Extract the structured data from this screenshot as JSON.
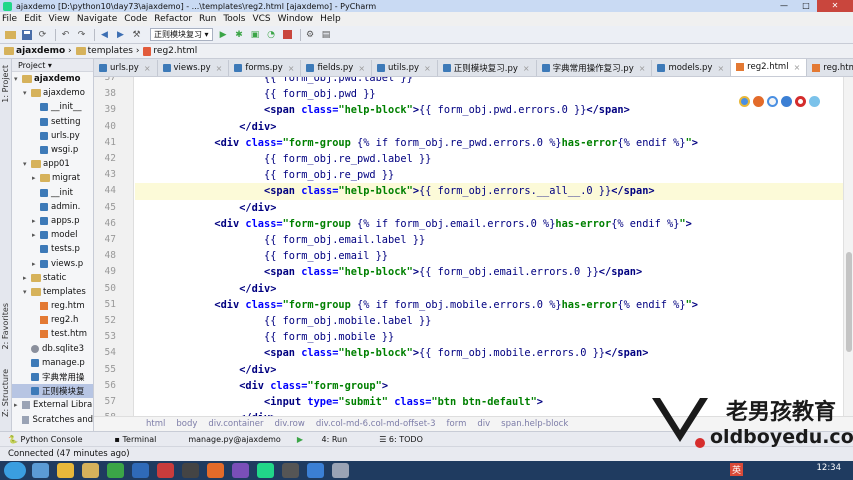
{
  "window": {
    "title": "ajaxdemo [D:\\python10\\day73\\ajaxdemo] - ...\\templates\\reg2.html [ajaxdemo] - PyCharm",
    "minimize": "—",
    "maximize": "□",
    "close": "✕"
  },
  "menu": [
    "File",
    "Edit",
    "View",
    "Navigate",
    "Code",
    "Refactor",
    "Run",
    "Tools",
    "VCS",
    "Window",
    "Help"
  ],
  "toolbar": {
    "run_config": "正则模块复习 ▾"
  },
  "navbar": {
    "crumbs": [
      "ajaxdemo",
      "templates",
      "reg2.html"
    ]
  },
  "side_tabs": {
    "project": "1: Project",
    "favorites": "2: Favorites",
    "structure": "Z: Structure"
  },
  "project_panel": {
    "header": "Project ▾",
    "tree": [
      {
        "arrow": "▾",
        "label": "ajaxdemo",
        "indent": 0,
        "kind": "folder"
      },
      {
        "arrow": "▾",
        "label": "ajaxdemo",
        "indent": 1,
        "kind": "folder"
      },
      {
        "arrow": "",
        "label": "__init__",
        "indent": 2,
        "kind": "py"
      },
      {
        "arrow": "",
        "label": "setting",
        "indent": 2,
        "kind": "py"
      },
      {
        "arrow": "",
        "label": "urls.py",
        "indent": 2,
        "kind": "py"
      },
      {
        "arrow": "",
        "label": "wsgi.p",
        "indent": 2,
        "kind": "py"
      },
      {
        "arrow": "▾",
        "label": "app01",
        "indent": 1,
        "kind": "folder"
      },
      {
        "arrow": "▸",
        "label": "migrat",
        "indent": 2,
        "kind": "folder"
      },
      {
        "arrow": "",
        "label": "__init",
        "indent": 2,
        "kind": "py"
      },
      {
        "arrow": "",
        "label": "admin.",
        "indent": 2,
        "kind": "py"
      },
      {
        "arrow": "▸",
        "label": "apps.p",
        "indent": 2,
        "kind": "py"
      },
      {
        "arrow": "▸",
        "label": "model",
        "indent": 2,
        "kind": "py"
      },
      {
        "arrow": "",
        "label": "tests.p",
        "indent": 2,
        "kind": "py"
      },
      {
        "arrow": "▸",
        "label": "views.p",
        "indent": 2,
        "kind": "py"
      },
      {
        "arrow": "▸",
        "label": "static",
        "indent": 1,
        "kind": "folder"
      },
      {
        "arrow": "▾",
        "label": "templates",
        "indent": 1,
        "kind": "folder"
      },
      {
        "arrow": "",
        "label": "reg.htm",
        "indent": 2,
        "kind": "html"
      },
      {
        "arrow": "",
        "label": "reg2.h",
        "indent": 2,
        "kind": "html"
      },
      {
        "arrow": "",
        "label": "test.htm",
        "indent": 2,
        "kind": "html"
      },
      {
        "arrow": "",
        "label": "db.sqlite3",
        "indent": 1,
        "kind": "db"
      },
      {
        "arrow": "",
        "label": "manage.p",
        "indent": 1,
        "kind": "py"
      },
      {
        "arrow": "",
        "label": "字典常用操",
        "indent": 1,
        "kind": "py"
      },
      {
        "arrow": "",
        "label": "正则模块复",
        "indent": 1,
        "kind": "py",
        "selected": true
      },
      {
        "arrow": "▸",
        "label": "External Libra",
        "indent": 0,
        "kind": "lib"
      },
      {
        "arrow": "",
        "label": "Scratches and",
        "indent": 0,
        "kind": "lib"
      }
    ]
  },
  "tabs": [
    {
      "label": "urls.py",
      "active": false
    },
    {
      "label": "views.py",
      "active": false
    },
    {
      "label": "forms.py",
      "active": false
    },
    {
      "label": "fields.py",
      "active": false
    },
    {
      "label": "utils.py",
      "active": false
    },
    {
      "label": "正则模块复习.py",
      "active": false
    },
    {
      "label": "字典常用操作复习.py",
      "active": false
    },
    {
      "label": "models.py",
      "active": false
    },
    {
      "label": "reg2.html",
      "active": true
    },
    {
      "label": "reg.html",
      "active": false
    }
  ],
  "editor": {
    "first_line": 37,
    "current_line": 44,
    "lines": [
      {
        "n": 37,
        "indent": 5,
        "parts": [
          [
            "tpl",
            "{{ form_obj.pwd.label }}"
          ]
        ]
      },
      {
        "n": 38,
        "indent": 5,
        "parts": [
          [
            "tpl",
            "{{ form_obj.pwd }}"
          ]
        ]
      },
      {
        "n": 39,
        "indent": 5,
        "parts": [
          [
            "tag",
            "<span "
          ],
          [
            "attr",
            "class="
          ],
          [
            "str",
            "\"help-block\""
          ],
          [
            "tag",
            ">"
          ],
          [
            "tpl",
            "{{ form_obj.pwd.errors.0 }}"
          ],
          [
            "tag",
            "</span>"
          ]
        ]
      },
      {
        "n": 40,
        "indent": 3,
        "parts": [
          [
            "tag",
            "</div>"
          ]
        ]
      },
      {
        "n": 41,
        "indent": 1,
        "parts": [
          [
            "tag",
            "<div "
          ],
          [
            "attr",
            "class="
          ],
          [
            "str",
            "\"form-group "
          ],
          [
            "tpl",
            "{% if form_obj.re_pwd.errors.0 %}"
          ],
          [
            "str",
            "has-error"
          ],
          [
            "tpl",
            "{% endif %}"
          ],
          [
            "str",
            "\""
          ],
          [
            "tag",
            ">"
          ]
        ]
      },
      {
        "n": 42,
        "indent": 5,
        "parts": [
          [
            "tpl",
            "{{ form_obj.re_pwd.label }}"
          ]
        ]
      },
      {
        "n": 43,
        "indent": 5,
        "parts": [
          [
            "tpl",
            "{{ form_obj.re_pwd }}"
          ]
        ]
      },
      {
        "n": 44,
        "indent": 5,
        "parts": [
          [
            "tag",
            "<span "
          ],
          [
            "attr",
            "class="
          ],
          [
            "str",
            "\"help-block\""
          ],
          [
            "tag",
            ">"
          ],
          [
            "tpl",
            "{{ form_obj.errors.__all__.0 }}"
          ],
          [
            "tag",
            "</span>"
          ]
        ]
      },
      {
        "n": 45,
        "indent": 3,
        "parts": [
          [
            "tag",
            "</div>"
          ]
        ]
      },
      {
        "n": 46,
        "indent": 1,
        "parts": [
          [
            "tag",
            "<div "
          ],
          [
            "attr",
            "class="
          ],
          [
            "str",
            "\"form-group "
          ],
          [
            "tpl",
            "{% if form_obj.email.errors.0 %}"
          ],
          [
            "str",
            "has-error"
          ],
          [
            "tpl",
            "{% endif %}"
          ],
          [
            "str",
            "\""
          ],
          [
            "tag",
            ">"
          ]
        ]
      },
      {
        "n": 47,
        "indent": 5,
        "parts": [
          [
            "tpl",
            "{{ form_obj.email.label }}"
          ]
        ]
      },
      {
        "n": 48,
        "indent": 5,
        "parts": [
          [
            "tpl",
            "{{ form_obj.email }}"
          ]
        ]
      },
      {
        "n": 49,
        "indent": 5,
        "parts": [
          [
            "tag",
            "<span "
          ],
          [
            "attr",
            "class="
          ],
          [
            "str",
            "\"help-block\""
          ],
          [
            "tag",
            ">"
          ],
          [
            "tpl",
            "{{ form_obj.email.errors.0 }}"
          ],
          [
            "tag",
            "</span>"
          ]
        ]
      },
      {
        "n": 50,
        "indent": 3,
        "parts": [
          [
            "tag",
            "</div>"
          ]
        ]
      },
      {
        "n": 51,
        "indent": 1,
        "parts": [
          [
            "tag",
            "<div "
          ],
          [
            "attr",
            "class="
          ],
          [
            "str",
            "\"form-group "
          ],
          [
            "tpl",
            "{% if form_obj.mobile.errors.0 %}"
          ],
          [
            "str",
            "has-error"
          ],
          [
            "tpl",
            "{% endif %}"
          ],
          [
            "str",
            "\""
          ],
          [
            "tag",
            ">"
          ]
        ]
      },
      {
        "n": 52,
        "indent": 5,
        "parts": [
          [
            "tpl",
            "{{ form_obj.mobile.label }}"
          ]
        ]
      },
      {
        "n": 53,
        "indent": 5,
        "parts": [
          [
            "tpl",
            "{{ form_obj.mobile }}"
          ]
        ]
      },
      {
        "n": 54,
        "indent": 5,
        "parts": [
          [
            "tag",
            "<span "
          ],
          [
            "attr",
            "class="
          ],
          [
            "str",
            "\"help-block\""
          ],
          [
            "tag",
            ">"
          ],
          [
            "tpl",
            "{{ form_obj.mobile.errors.0 }}"
          ],
          [
            "tag",
            "</span>"
          ]
        ]
      },
      {
        "n": 55,
        "indent": 3,
        "parts": [
          [
            "tag",
            "</div>"
          ]
        ]
      },
      {
        "n": 56,
        "indent": 3,
        "parts": [
          [
            "tag",
            "<div "
          ],
          [
            "attr",
            "class="
          ],
          [
            "str",
            "\"form-group\""
          ],
          [
            "tag",
            ">"
          ]
        ]
      },
      {
        "n": 57,
        "indent": 5,
        "parts": [
          [
            "tag",
            "<input "
          ],
          [
            "attr",
            "type="
          ],
          [
            "str",
            "\"submit\" "
          ],
          [
            "attr",
            "class="
          ],
          [
            "str",
            "\"btn btn-default\""
          ],
          [
            "tag",
            ">"
          ]
        ]
      },
      {
        "n": 58,
        "indent": 3,
        "parts": [
          [
            "tag",
            "</div>"
          ]
        ]
      }
    ]
  },
  "breadcrumb_path": [
    "html",
    "body",
    "div.container",
    "div.row",
    "div.col-md-6.col-md-offset-3",
    "form",
    "div",
    "span.help-block"
  ],
  "tool_windows": [
    "Python Console",
    "Terminal",
    "manage.py@ajaxdemo",
    "4: Run",
    "6: TODO"
  ],
  "status": "Connected (47 minutes ago)",
  "taskbar": {
    "lang": "英",
    "time": "12:34"
  },
  "watermark": {
    "cn": "老男孩教育",
    "en": "oldboyedu.com"
  },
  "colors": {
    "tag": "#000080",
    "attr": "#0000ff",
    "string": "#008000",
    "current_line": "#fcfad8"
  }
}
